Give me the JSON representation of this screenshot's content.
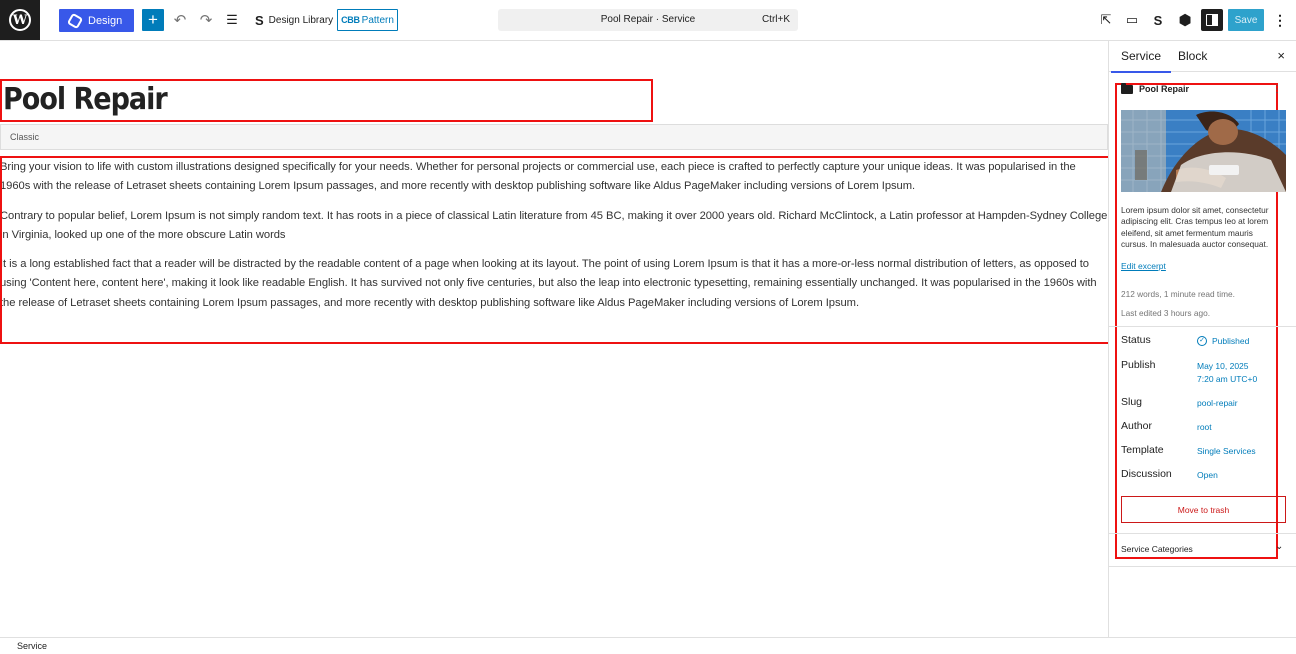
{
  "toolbar": {
    "wp_logo_icon": "wordpress-icon",
    "design_label": "Design",
    "add_label": "+",
    "undo_icon": "↶",
    "redo_icon": "↷",
    "list_view_icon": "☰",
    "design_library_icon": "S",
    "design_library_label": "Design Library",
    "pattern_prefix": "CBB",
    "pattern_label": "Pattern",
    "command_title": "Pool Repair · Service",
    "command_shortcut": "Ctrl+K",
    "view_post_icon": "⇱",
    "preview_icon": "▭",
    "stackable_icon": "S",
    "block_icon": "⬢",
    "save_label": "Save",
    "more_icon": "⋮",
    "accent_color": "#3858e9",
    "primary_color": "#007cba"
  },
  "editor": {
    "title": "Pool Repair",
    "classic_label": "Classic",
    "paragraphs": [
      "Bring your vision to life with custom illustrations designed specifically for your needs. Whether for personal projects or commercial use, each piece is crafted to perfectly capture your unique ideas. It was popularised in the 1960s with the release of Letraset sheets containing Lorem Ipsum passages, and more recently with desktop publishing software like Aldus PageMaker including versions of Lorem Ipsum.",
      "Contrary to popular belief, Lorem Ipsum is not simply random text. It has roots in a piece of classical Latin literature from 45 BC, making it over 2000 years old. Richard McClintock, a Latin professor at Hampden-Sydney College in Virginia, looked up one of the more obscure Latin words",
      "It is a long established fact that a reader will be distracted by the readable content of a page when looking at its layout. The point of using Lorem Ipsum is that it has a more-or-less normal distribution of letters, as opposed to using 'Content here, content here', making it look like readable English. It has survived not only five centuries, but also the leap into electronic typesetting, remaining essentially unchanged. It was popularised in the 1960s with the release of Letraset sheets containing Lorem Ipsum passages, and more recently with desktop publishing software like Aldus PageMaker including versions of Lorem Ipsum."
    ]
  },
  "sidebar": {
    "tab_service": "Service",
    "tab_block": "Block",
    "close_icon": "×",
    "post_title": "Pool Repair",
    "excerpt_lines": [
      "Lorem ipsum dolor sit amet, consectetur",
      "adipiscing elit. Cras tempus leo at lorem",
      "eleifend, sit amet fermentum mauris",
      "cursus. In malesuada auctor consequat."
    ],
    "edit_excerpt": "Edit excerpt",
    "word_count": "212 words, 1 minute read time.",
    "last_edited": "Last edited 3 hours ago.",
    "rows": {
      "status_label": "Status",
      "status_value": "Published",
      "publish_label": "Publish",
      "publish_date": "May 10, 2025",
      "publish_time": "7:20 am UTC+0",
      "slug_label": "Slug",
      "slug_value": "pool-repair",
      "author_label": "Author",
      "author_value": "root",
      "template_label": "Template",
      "template_value": "Single Services",
      "discussion_label": "Discussion",
      "discussion_value": "Open"
    },
    "trash_label": "Move to trash",
    "categories_label": "Service Categories",
    "chevron_icon": "⌄"
  },
  "footer": {
    "breadcrumb": "Service"
  }
}
